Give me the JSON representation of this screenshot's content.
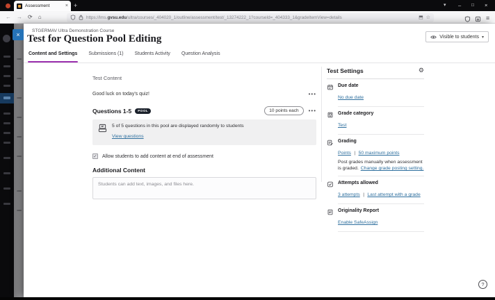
{
  "colors": {
    "accent_purple": "#9b2fae",
    "link_blue": "#2e6f9e",
    "close_button_blue": "#2573b8",
    "pool_badge": "#1b212b"
  },
  "icons": {
    "back": "←",
    "forward": "→",
    "reload": "⟳",
    "home": "⌂",
    "star": "☆",
    "reader": "⬒",
    "menu": "≡",
    "caret_down": "▾",
    "minimize": "–",
    "maximize": "□",
    "close": "×",
    "ellipsis": "•••",
    "gear": "⚙",
    "check": "✓",
    "help": "?",
    "new_tab": "+",
    "tab_close": "×"
  },
  "browser": {
    "tab_title": "Assessment",
    "url_prefix": "https://lms.",
    "url_domain": "gvsu.edu",
    "url_path": "/ultra/courses/_404020_1/outline/assessment/test/_13274222_1?courseId=_404333_1&gradeItemView=details"
  },
  "panel": {
    "course_name": "STGERMAV Ultra Demonstration Course",
    "title": "Test for Question Pool Editing",
    "visibility_button": "Visible to students",
    "tabs": [
      {
        "label": "Content and Settings",
        "active": true
      },
      {
        "label": "Submissions (1)",
        "active": false
      },
      {
        "label": "Students Activity",
        "active": false
      },
      {
        "label": "Question Analysis",
        "active": false
      }
    ]
  },
  "content": {
    "section_title": "Test Content",
    "instruction_text": "Good luck on today's quiz!",
    "pool": {
      "title": "Questions 1-5",
      "badge": "POOL",
      "points_label": "10 points each",
      "info": "5 of 5 questions in this pool are displayed randomly to students",
      "link": "View questions"
    },
    "checkbox_label": "Allow students to add content at end of assessment",
    "additional_title": "Additional Content",
    "additional_placeholder": "Students can add text, images, and files here."
  },
  "settings": {
    "title": "Test Settings",
    "due_date": {
      "label": "Due date",
      "link": "No due date"
    },
    "grade_category": {
      "label": "Grade category",
      "link": "Test"
    },
    "grading": {
      "label": "Grading",
      "link1": "Points",
      "sep": "|",
      "link2": "50 maximum points",
      "note": "Post grades manually when assessment is graded.",
      "note_link": "Change grade posting setting."
    },
    "attempts": {
      "label": "Attempts allowed",
      "link1": "3 attempts",
      "sep": "|",
      "link2": "Last attempt with a grade"
    },
    "originality": {
      "label": "Originality Report",
      "link": "Enable SafeAssign"
    }
  }
}
